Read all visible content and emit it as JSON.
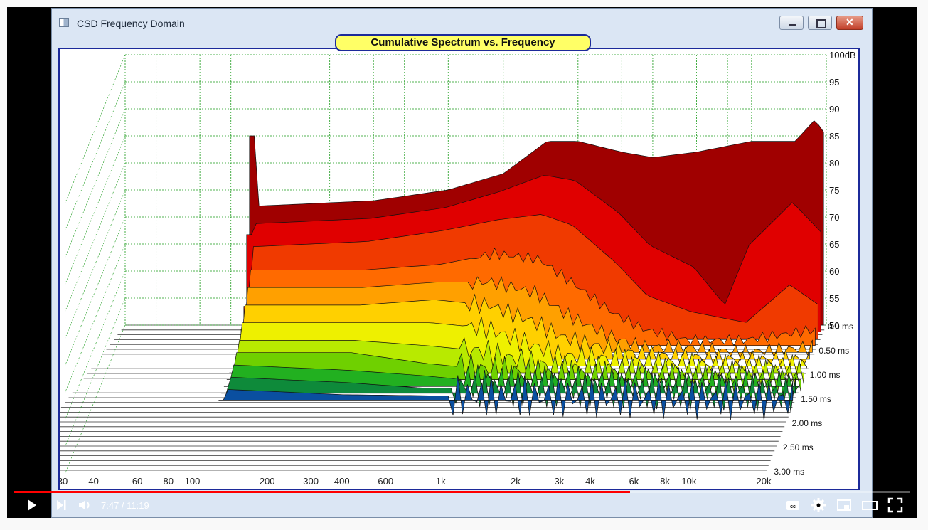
{
  "window": {
    "title": "CSD Frequency Domain",
    "icon": "app-window-icon"
  },
  "chart_data": {
    "type": "area",
    "title": "Cumulative Spectrum vs. Frequency",
    "x_scale": "log",
    "x_ticks": [
      "30",
      "40",
      "60",
      "80",
      "100",
      "200",
      "300",
      "400",
      "600",
      "1k",
      "2k",
      "3k",
      "4k",
      "6k",
      "8k",
      "10k",
      "20k"
    ],
    "x_tick_values": [
      30,
      40,
      60,
      80,
      100,
      200,
      300,
      400,
      600,
      1000,
      2000,
      3000,
      4000,
      6000,
      8000,
      10000,
      20000
    ],
    "y_ticks": [
      "100dB",
      "95",
      "90",
      "85",
      "80",
      "75",
      "70",
      "65",
      "60",
      "55",
      "50"
    ],
    "y_tick_values": [
      100,
      95,
      90,
      85,
      80,
      75,
      70,
      65,
      60,
      55,
      50
    ],
    "ylim": [
      50,
      100
    ],
    "z_ticks": [
      "0.0 ms",
      "0.50 ms",
      "1.00 ms",
      "1.50 ms",
      "2.00 ms",
      "2.50 ms",
      "3.00 ms"
    ],
    "z_tick_values": [
      0,
      0.5,
      1.0,
      1.5,
      2.0,
      2.5,
      3.0
    ],
    "grid": true,
    "series": [
      {
        "values": [
          [
            100,
            72
          ],
          [
            300,
            73
          ],
          [
            600,
            75
          ],
          [
            1000,
            78
          ],
          [
            1500,
            84
          ],
          [
            2000,
            84
          ],
          [
            3000,
            82
          ],
          [
            4000,
            81
          ],
          [
            6000,
            82
          ],
          [
            10000,
            84
          ],
          [
            15000,
            84
          ],
          [
            18000,
            88
          ],
          [
            20000,
            85
          ]
        ]
      },
      {
        "values": [
          [
            100,
            70
          ],
          [
            300,
            71
          ],
          [
            600,
            73
          ],
          [
            1000,
            76
          ],
          [
            1500,
            79
          ],
          [
            2000,
            78
          ],
          [
            3000,
            72
          ],
          [
            4000,
            66
          ],
          [
            6000,
            62
          ],
          [
            8000,
            55
          ],
          [
            10000,
            66
          ],
          [
            15000,
            74
          ],
          [
            20000,
            68
          ]
        ]
      },
      {
        "values": [
          [
            100,
            67
          ],
          [
            300,
            68
          ],
          [
            600,
            70
          ],
          [
            1000,
            72
          ],
          [
            1500,
            73
          ],
          [
            2000,
            71
          ],
          [
            3000,
            64
          ],
          [
            4000,
            58
          ],
          [
            6000,
            55
          ],
          [
            10000,
            53
          ],
          [
            15000,
            60
          ],
          [
            20000,
            56
          ]
        ]
      },
      {
        "values": [
          [
            100,
            64
          ],
          [
            300,
            64
          ],
          [
            600,
            65
          ],
          [
            1000,
            67
          ],
          [
            1500,
            66
          ],
          [
            2000,
            62
          ],
          [
            3000,
            56
          ],
          [
            4000,
            53
          ],
          [
            6000,
            51
          ],
          [
            10000,
            51
          ],
          [
            20000,
            53
          ]
        ]
      },
      {
        "values": [
          [
            100,
            62
          ],
          [
            300,
            62
          ],
          [
            600,
            63
          ],
          [
            1000,
            63
          ],
          [
            1500,
            61
          ],
          [
            2000,
            57
          ],
          [
            3000,
            53
          ],
          [
            4000,
            51
          ],
          [
            6000,
            51
          ],
          [
            10000,
            50
          ],
          [
            20000,
            51
          ]
        ]
      },
      {
        "values": [
          [
            100,
            60
          ],
          [
            300,
            60
          ],
          [
            600,
            61
          ],
          [
            1000,
            60
          ],
          [
            1500,
            57
          ],
          [
            2000,
            54
          ],
          [
            3000,
            52
          ],
          [
            4000,
            51
          ],
          [
            10000,
            50
          ],
          [
            20000,
            50
          ]
        ]
      },
      {
        "values": [
          [
            100,
            58
          ],
          [
            300,
            58
          ],
          [
            600,
            58
          ],
          [
            1000,
            57
          ],
          [
            1500,
            54
          ],
          [
            2000,
            52
          ],
          [
            4000,
            51
          ],
          [
            10000,
            50
          ],
          [
            20000,
            50
          ]
        ]
      },
      {
        "values": [
          [
            100,
            56
          ],
          [
            300,
            56
          ],
          [
            600,
            55
          ],
          [
            1000,
            54
          ],
          [
            1500,
            52
          ],
          [
            2000,
            51
          ],
          [
            10000,
            50
          ],
          [
            20000,
            50
          ]
        ]
      },
      {
        "values": [
          [
            100,
            55
          ],
          [
            300,
            55
          ],
          [
            600,
            53
          ],
          [
            1000,
            52
          ],
          [
            2000,
            51
          ],
          [
            10000,
            50
          ],
          [
            20000,
            50
          ]
        ]
      },
      {
        "values": [
          [
            100,
            54
          ],
          [
            300,
            53
          ],
          [
            600,
            52
          ],
          [
            1000,
            51
          ],
          [
            20000,
            50
          ]
        ]
      },
      {
        "values": [
          [
            100,
            53
          ],
          [
            300,
            52
          ],
          [
            600,
            51
          ],
          [
            20000,
            50
          ]
        ]
      },
      {
        "values": [
          [
            100,
            52
          ],
          [
            300,
            51
          ],
          [
            20000,
            50
          ]
        ]
      }
    ]
  },
  "player": {
    "time": "7:47 / 11:19",
    "progress": 0.688,
    "icons": [
      "play-icon",
      "next-icon",
      "volume-icon",
      "captions-icon",
      "settings-icon",
      "miniplayer-icon",
      "theater-icon",
      "fullscreen-icon"
    ]
  }
}
